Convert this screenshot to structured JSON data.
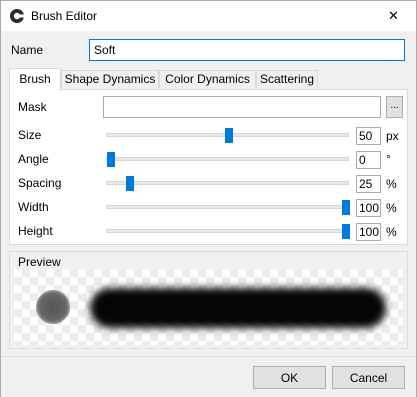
{
  "window": {
    "title": "Brush Editor",
    "close_glyph": "✕",
    "app_icon": "app-icon"
  },
  "name": {
    "label": "Name",
    "value": "Soft"
  },
  "tabs": [
    {
      "label": "Brush",
      "active": true
    },
    {
      "label": "Shape Dynamics",
      "active": false
    },
    {
      "label": "Color Dynamics",
      "active": false
    },
    {
      "label": "Scattering",
      "active": false
    }
  ],
  "brush": {
    "mask": {
      "label": "Mask",
      "value": "",
      "browse_label": "..."
    },
    "size": {
      "label": "Size",
      "value": "50",
      "unit": "px",
      "slider_fraction": 0.5
    },
    "angle": {
      "label": "Angle",
      "value": "0",
      "unit": "°",
      "slider_fraction": 0.0
    },
    "spacing": {
      "label": "Spacing",
      "value": "25",
      "unit": "%",
      "slider_fraction": 0.08
    },
    "width": {
      "label": "Width",
      "value": "100",
      "unit": "%",
      "slider_fraction": 1.0
    },
    "height": {
      "label": "Height",
      "value": "100",
      "unit": "%",
      "slider_fraction": 1.0
    }
  },
  "preview": {
    "label": "Preview"
  },
  "buttons": {
    "ok": "OK",
    "cancel": "Cancel"
  },
  "colors": {
    "accent": "#0078d7",
    "slider_thumb": "#007ad9"
  }
}
